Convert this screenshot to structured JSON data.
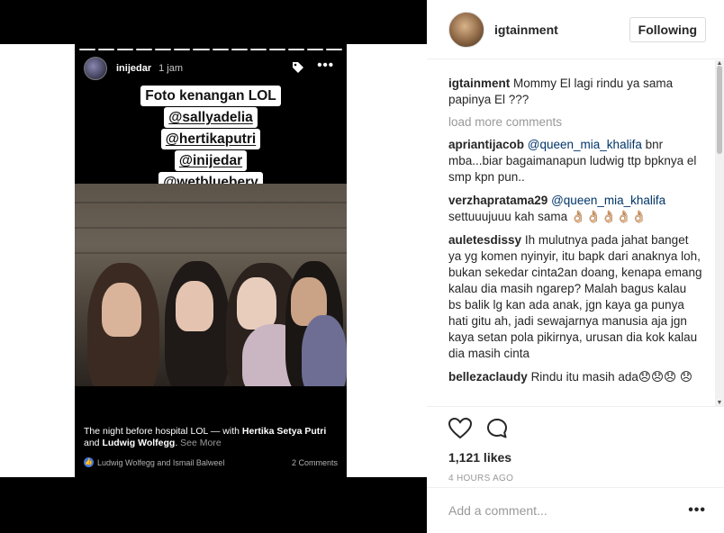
{
  "story": {
    "username": "inijedar",
    "time": "1 jam",
    "caption_lines": [
      "Foto kenangan LOL",
      "@sallyadelia",
      "@hertikaputri",
      "@inijedar",
      "@wetbluebery"
    ],
    "footer_prefix": "The night before hospital LOL — with ",
    "footer_tag1": "Hertika Setya Putri",
    "footer_and": " and ",
    "footer_tag2": "Ludwig Wolfegg",
    "footer_dot": ". ",
    "see_more": "See More",
    "likes_text": "Ludwig Wolfegg and Ismail Balweel",
    "comments_count": "2 Comments",
    "icons": {
      "tag": "tag-icon",
      "more": "more-horizontal-icon",
      "like": "facebook-like-icon"
    }
  },
  "post": {
    "username": "igtainment",
    "follow_label": "Following",
    "caption_user": "igtainment",
    "caption_text": "Mommy El lagi rindu ya sama papinya El ???",
    "load_more": "load more comments",
    "comments": [
      {
        "user": "apriantijacob",
        "mention": "@queen_mia_khalifa",
        "text": "bnr mba...biar bagaimanapun ludwig ttp bpknya el smp kpn pun.."
      },
      {
        "user": "verzhapratama29",
        "mention": "@queen_mia_khalifa",
        "text": "settuuujuuu kah sama 👌🏼👌🏼👌🏼👌🏼👌🏼"
      },
      {
        "user": "auletesdissy",
        "mention": "",
        "text": "Ih mulutnya pada jahat banget ya yg komen nyinyir, itu bapk dari anaknya loh, bukan sekedar cinta2an doang, kenapa emang kalau dia masih ngarep? Malah bagus kalau bs balik lg kan ada anak, jgn kaya ga punya hati gitu ah, jadi sewajarnya manusia aja jgn kaya setan pola pikirnya, urusan dia kok kalau dia masih cinta"
      },
      {
        "user": "bellezaclaudy",
        "mention": "",
        "text": "Rindu itu masih ada😞😞😞 😞"
      }
    ],
    "likes": "1,121 likes",
    "time": "4 HOURS AGO",
    "comment_placeholder": "Add a comment...",
    "more_dots": "•••",
    "icons": {
      "like": "heart-icon",
      "comment": "comment-bubble-icon"
    }
  }
}
